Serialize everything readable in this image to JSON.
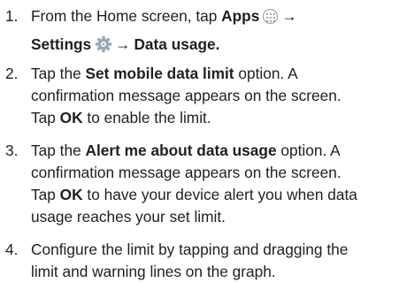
{
  "steps": [
    {
      "num": "1.",
      "line1": {
        "t1": "From the Home screen, tap ",
        "b1": "Apps",
        "arrow": "→"
      },
      "line2": {
        "b1": "Settings",
        "arrow": "→",
        "b2": "Data usage."
      }
    },
    {
      "num": "2.",
      "pre": "Tap the ",
      "bold": "Set mobile data limit",
      "post": " option. A",
      "line2": "confirmation message appears on the screen.",
      "line3_pre": "Tap ",
      "line3_bold": "OK",
      "line3_post": " to enable the limit."
    },
    {
      "num": "3.",
      "pre": "Tap the ",
      "bold": "Alert me about data usage",
      "post": " option. A",
      "line2": "confirmation message appears on the screen.",
      "line3_pre": "Tap ",
      "line3_bold": "OK",
      "line3_post": " to have your device alert you when data",
      "line4": "usage reaches your set limit."
    },
    {
      "num": "4.",
      "line1": "Configure the limit by tapping and dragging the",
      "line2": "limit and warning lines on the graph."
    }
  ],
  "icons": {
    "apps": "apps-icon",
    "settings": "gear-icon",
    "settings_color": "#9aa8b3"
  }
}
